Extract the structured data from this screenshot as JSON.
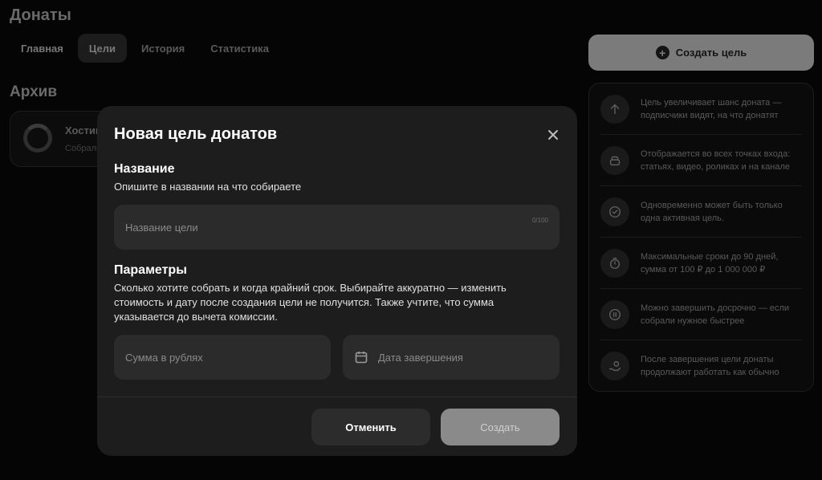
{
  "page": {
    "title": "Донаты",
    "tabs": [
      {
        "label": "Главная"
      },
      {
        "label": "Цели"
      },
      {
        "label": "История"
      },
      {
        "label": "Статистика"
      }
    ],
    "active_tab": "Цели",
    "archive": {
      "title": "Архив",
      "card": {
        "name": "Хостинг",
        "subtitle": "Собрали"
      }
    }
  },
  "sidebar": {
    "create_button": "Создать цель",
    "info_items": [
      {
        "icon": "arrow-up-icon",
        "text": "Цель увеличивает шанс доната — подписчики видят, на что донатят"
      },
      {
        "icon": "stack-icon",
        "text": "Отображается во всех точках входа: статьях, видео, роликах и на канале"
      },
      {
        "icon": "check-circle-icon",
        "text": "Одновременно может быть только одна активная цель."
      },
      {
        "icon": "stopwatch-icon",
        "text": "Максимальные сроки до 90 дней, сумма от 100 ₽ до 1 000 000 ₽"
      },
      {
        "icon": "pause-circle-icon",
        "text": "Можно завершить досрочно — если собрали нужное быстрее"
      },
      {
        "icon": "hand-coin-icon",
        "text": "После завершения цели донаты продолжают работать как обычно"
      }
    ]
  },
  "modal": {
    "title": "Новая цель донатов",
    "name_section": {
      "title": "Название",
      "description": "Опишите в названии на что собираете",
      "placeholder": "Название цели",
      "counter": "0/100"
    },
    "params_section": {
      "title": "Параметры",
      "description": "Сколько хотите собрать и когда крайний срок. Выбирайте аккуратно — изменить стоимость и дату после создания цели не получится. Также учтите, что сумма указывается до вычета комиссии.",
      "amount_placeholder": "Сумма в рублях",
      "date_placeholder": "Дата завершения"
    },
    "cancel_label": "Отменить",
    "create_label": "Создать"
  }
}
